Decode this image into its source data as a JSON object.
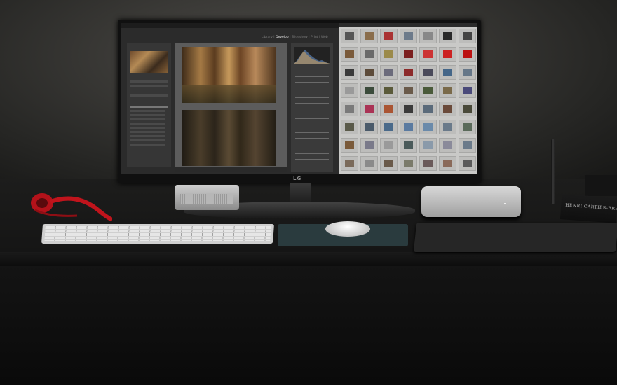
{
  "monitor": {
    "brand": "LG",
    "lightroom": {
      "modules": [
        "Library",
        "Develop",
        "Slideshow",
        "Print",
        "Web"
      ],
      "active_module": "Develop"
    }
  },
  "book": {
    "spine_text": "HENRI CARTIER-BRESSON PHOTO"
  },
  "colors": {
    "headphones": "#c0141c",
    "mousepad": "#2a3b3e",
    "grid_bg": "#c9c9c7"
  },
  "thumbnails": [
    "#555",
    "#8a6d4b",
    "#a33",
    "#6c7a8a",
    "#888",
    "#2a2a2a",
    "#444",
    "#7a5a3a",
    "#6a6a6a",
    "#9b8a4a",
    "#7b1f1f",
    "#c33",
    "#c22",
    "#b11",
    "#3a3a3a",
    "#5c4b3a",
    "#6b6b7b",
    "#8c2a2a",
    "#4a4a5a",
    "#446688",
    "#667788",
    "#9a9a9a",
    "#3b4b3b",
    "#5a5a3a",
    "#6a5a4a",
    "#4a5a3a",
    "#7a6a4a",
    "#4a4a7a",
    "#7a7a7a",
    "#aa3355",
    "#aa5533",
    "#3a3a3a",
    "#5a6a7a",
    "#6a4a3a",
    "#4a4a3a",
    "#5a5a4a",
    "#4a5a6a",
    "#4a6a8a",
    "#5a7aa0",
    "#6a8aaa",
    "#6a7a8a",
    "#5a6a5a",
    "#7a5a3a",
    "#7a7a8a",
    "#9a9a9a",
    "#4a5a5a",
    "#8a9aaa",
    "#8a8a9a",
    "#6a7a8a",
    "#7a6a5a",
    "#8a8a8a",
    "#6a5a4a",
    "#7a7a6a",
    "#6a5a5a",
    "#8a6a5a",
    "#5a5a5a"
  ]
}
